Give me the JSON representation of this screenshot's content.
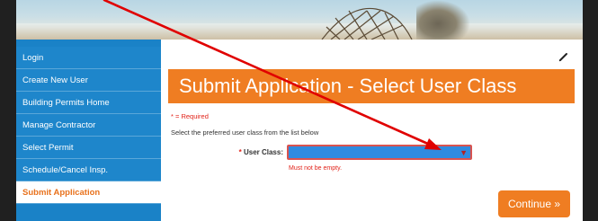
{
  "sidebar": {
    "items": [
      {
        "label": "Login"
      },
      {
        "label": "Create New User"
      },
      {
        "label": "Building Permits Home"
      },
      {
        "label": "Manage Contractor"
      },
      {
        "label": "Select Permit"
      },
      {
        "label": "Schedule/Cancel Insp."
      },
      {
        "label": "Submit Application"
      }
    ]
  },
  "main": {
    "title": "Submit Application - Select User Class",
    "required_note": "* = Required",
    "instruction": "Select the preferred user class from the list below",
    "field": {
      "star": "*",
      "label": "User Class:",
      "error": "Must not be empty."
    },
    "continue_label": "Continue »"
  },
  "colors": {
    "accent_orange": "#ef7d22",
    "sidebar_blue": "#1a82c7",
    "error_red": "#e2231a",
    "annotation_red": "#e00000"
  },
  "icons": {
    "edit": "pencil-icon",
    "dropdown": "chevron-down-icon"
  }
}
